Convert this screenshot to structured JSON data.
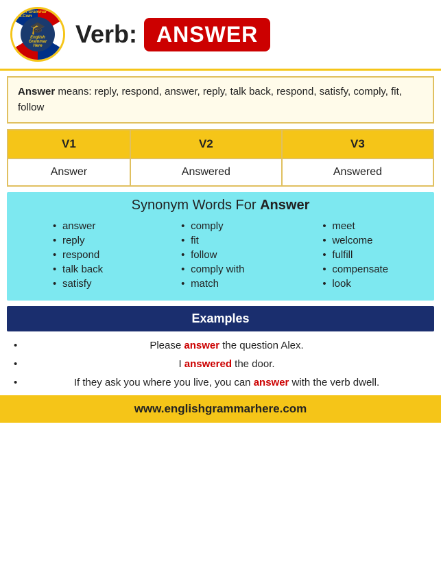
{
  "header": {
    "verb_label": "Verb:",
    "verb_word": "ANSWER",
    "logo_text": "English Grammar Here.Com"
  },
  "definition": {
    "prefix": "Answer",
    "text": " means: reply, respond, answer, reply, talk back, respond, satisfy, comply, fit, follow"
  },
  "verb_forms": {
    "headers": [
      "V1",
      "V2",
      "V3"
    ],
    "rows": [
      [
        "Answer",
        "Answered",
        "Answered"
      ]
    ]
  },
  "synonyms": {
    "title_text": "Synonym Words For ",
    "title_word": "Answer",
    "columns": [
      [
        "answer",
        "reply",
        "respond",
        "talk back",
        "satisfy"
      ],
      [
        "comply",
        "fit",
        "follow",
        "comply with",
        "match"
      ],
      [
        "meet",
        "welcome",
        "fulfill",
        "compensate",
        "look"
      ]
    ]
  },
  "examples": {
    "section_label": "Examples",
    "items": [
      {
        "before": "Please ",
        "highlight": "answer",
        "after": " the question Alex."
      },
      {
        "before": "I ",
        "highlight": "answered",
        "after": " the door."
      },
      {
        "before": "If they ask you where you live, you can ",
        "highlight": "answer",
        "after": " with the verb dwell."
      }
    ]
  },
  "footer": {
    "url": "www.englishgrammarhere.com"
  }
}
